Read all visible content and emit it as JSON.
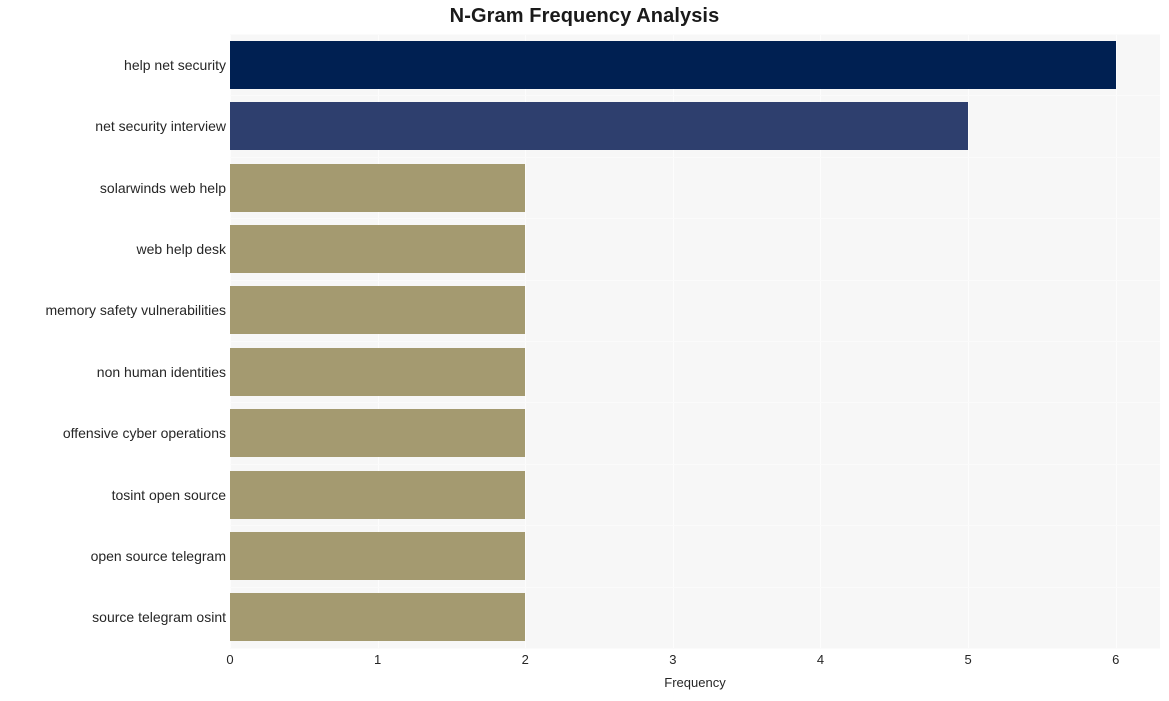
{
  "chart_data": {
    "type": "bar",
    "orientation": "horizontal",
    "title": "N-Gram Frequency Analysis",
    "xlabel": "Frequency",
    "ylabel": "",
    "categories": [
      "help net security",
      "net security interview",
      "solarwinds web help",
      "web help desk",
      "memory safety vulnerabilities",
      "non human identities",
      "offensive cyber operations",
      "tosint open source",
      "open source telegram",
      "source telegram osint"
    ],
    "values": [
      6,
      5,
      2,
      2,
      2,
      2,
      2,
      2,
      2,
      2
    ],
    "bar_colors": [
      "#002052",
      "#2e3f6e",
      "#a49a70",
      "#a49a70",
      "#a49a70",
      "#a49a70",
      "#a49a70",
      "#a49a70",
      "#a49a70",
      "#a49a70"
    ],
    "xlim": [
      0,
      6.3
    ],
    "xticks": [
      0,
      1,
      2,
      3,
      4,
      5,
      6
    ],
    "xtick_labels": [
      "0",
      "1",
      "2",
      "3",
      "4",
      "5",
      "6"
    ],
    "grid": true,
    "legend": null,
    "plot_background": "#f7f7f7",
    "figure_background": "#ffffff",
    "gridline_color": "#fdfdfd"
  }
}
